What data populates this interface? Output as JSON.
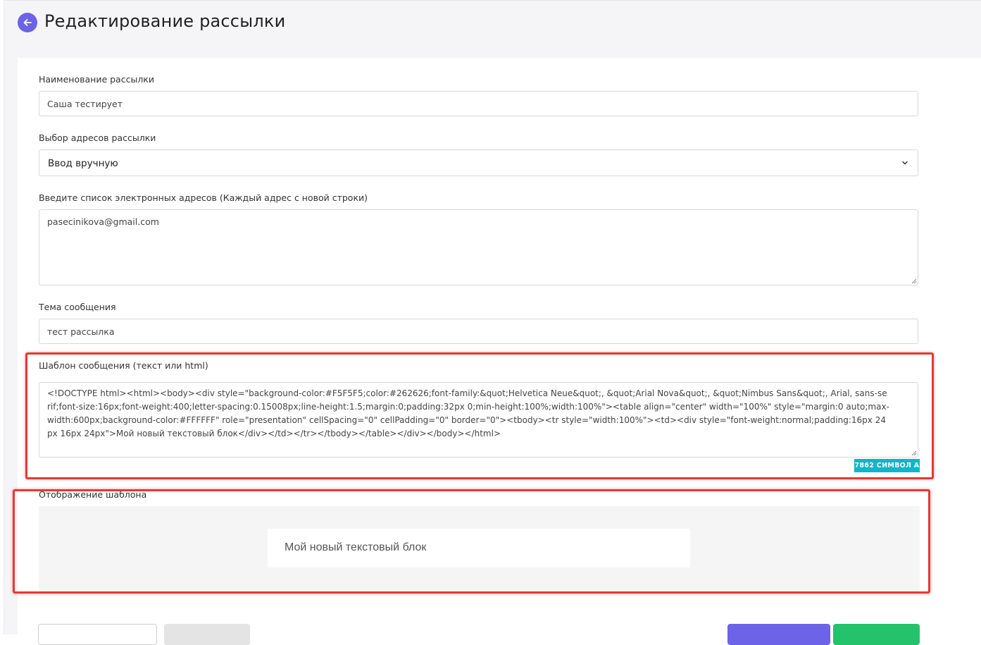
{
  "header": {
    "title": "Редактирование рассылки",
    "back_icon": "arrow-left-icon"
  },
  "form": {
    "name": {
      "label": "Наименование рассылки",
      "value": "Саша тестирует"
    },
    "address_source": {
      "label": "Выбор адресов рассылки",
      "selected": "Ввод вручную"
    },
    "emails": {
      "label": "Введите список электронных адресов (Каждый адрес с новой строки)",
      "value": "pasecinikova@gmail.com"
    },
    "subject": {
      "label": "Тема сообщения",
      "value": "тест рассылка"
    },
    "template": {
      "label": "Шаблон сообщения (текст или html)",
      "value": "<!DOCTYPE html><html><body><div style=\"background-color:#F5F5F5;color:#262626;font-family:&quot;Helvetica Neue&quot;, &quot;Arial Nova&quot;, &quot;Nimbus Sans&quot;, Arial, sans-serif;font-size:16px;font-weight:400;letter-spacing:0.15008px;line-height:1.5;margin:0;padding:32px 0;min-height:100%;width:100%\"><table align=\"center\" width=\"100%\" style=\"margin:0 auto;max-width:600px;background-color:#FFFFFF\" role=\"presentation\" cellSpacing=\"0\" cellPadding=\"0\" border=\"0\"><tbody><tr style=\"width:100%\"><td><div style=\"font-weight:normal;padding:16px 24px 16px 24px\">Мой новый текстовый блок</div></td></tr></tbody></table></div></body></html>",
      "counter": "7862 СИМВОЛ А"
    },
    "preview": {
      "label": "Отображение шаблона",
      "block_text": "Мой новый текстовый блок"
    }
  },
  "buttons": {
    "outline_label": "",
    "grey_label": "",
    "purple_label": "",
    "green_label": ""
  },
  "colors": {
    "accent": "#6c63e8",
    "success": "#24c26a",
    "counter": "#11b4c9",
    "highlight": "#e53935"
  }
}
